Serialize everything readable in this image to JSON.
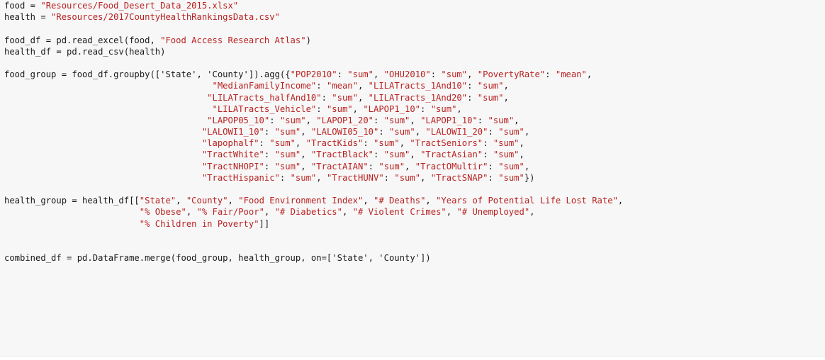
{
  "colors": {
    "background": "#f7f7f7",
    "text": "#1a1a1a",
    "string": "#ba2121"
  },
  "code_lines": [
    "food = \"Resources/Food_Desert_Data_2015.xlsx\"",
    "health = \"Resources/2017CountyHealthRankingsData.csv\"",
    "",
    "food_df = pd.read_excel(food, \"Food Access Research Atlas\")",
    "health_df = pd.read_csv(health)",
    "",
    "food_group = food_df.groupby(['State', 'County']).agg({\"POP2010\": \"sum\", \"OHU2010\": \"sum\", \"PovertyRate\": \"mean\",",
    "                                        \"MedianFamilyIncome\": \"mean\", \"LILATracts_1And10\": \"sum\",",
    "                                       \"LILATracts_halfAnd10\": \"sum\", \"LILATracts_1And20\": \"sum\",",
    "                                        \"LILATracts_Vehicle\": \"sum\", \"LAPOP1_10\": \"sum\",",
    "                                       \"LAPOP05_10\": \"sum\", \"LAPOP1_20\": \"sum\", \"LAPOP1_10\": \"sum\",",
    "                                      \"LALOWI1_10\": \"sum\", \"LALOWI05_10\": \"sum\", \"LALOWI1_20\": \"sum\",",
    "                                      \"lapophalf\": \"sum\", \"TractKids\": \"sum\", \"TractSeniors\": \"sum\",",
    "                                      \"TractWhite\": \"sum\", \"TractBlack\": \"sum\", \"TractAsian\": \"sum\",",
    "                                      \"TractNHOPI\": \"sum\", \"TractAIAN\": \"sum\", \"TractOMultir\": \"sum\",",
    "                                      \"TractHispanic\": \"sum\", \"TractHUNV\": \"sum\", \"TractSNAP\": \"sum\"})",
    "",
    "health_group = health_df[[\"State\", \"County\", \"Food Environment Index\", \"# Deaths\", \"Years of Potential Life Lost Rate\",",
    "                          \"% Obese\", \"% Fair/Poor\", \"# Diabetics\", \"# Violent Crimes\", \"# Unemployed\",",
    "                          \"% Children in Poverty\"]]",
    "",
    "",
    "combined_df = pd.DataFrame.merge(food_group, health_group, on=['State', 'County'])"
  ]
}
